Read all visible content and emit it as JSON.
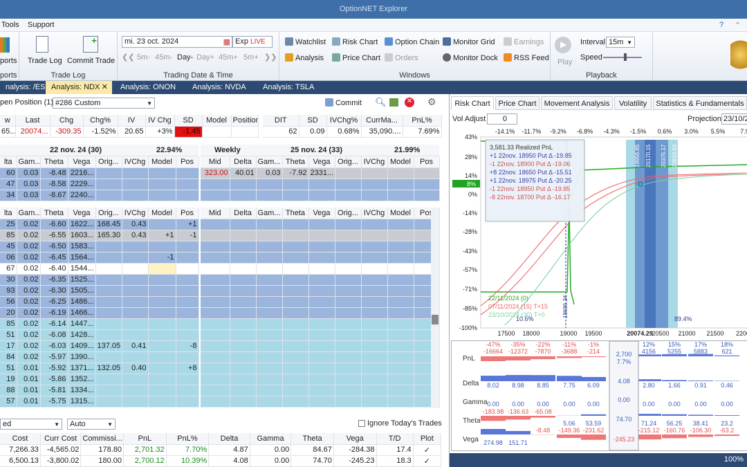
{
  "title": "OptionNET Explorer",
  "menu": [
    "Tools",
    "Support"
  ],
  "ribbon": {
    "reports": {
      "label1": "ports",
      "label2": "ports"
    },
    "tradelog": {
      "btn1": "Trade Log",
      "btn2": "Commit Trade",
      "group": "Trade Log"
    },
    "date": {
      "value": "mi. 23 oct. 2024",
      "exp": "Exp",
      "live": "LIVE",
      "steps": [
        "5m-",
        "45m-",
        "Day-",
        "Day+",
        "45m+",
        "5m+"
      ],
      "group": "Trading Date & Time"
    },
    "windows": {
      "items": [
        "Watchlist",
        "Risk Chart",
        "Option Chain",
        "Monitor Grid",
        "Earnings",
        "Analysis",
        "Price Chart",
        "Orders",
        "Monitor Dock",
        "RSS Feed"
      ],
      "group": "Windows"
    },
    "playback": {
      "play": "Play",
      "interval_label": "Interval",
      "interval": "15m",
      "speed_label": "Speed",
      "group": "Playback"
    }
  },
  "analysis_tabs": [
    "nalysis: /ES",
    "Analysis: NDX",
    "Analysis: ONON",
    "Analysis: NVDA",
    "Analysis: TSLA"
  ],
  "position": {
    "label": "pen Position (1)",
    "select": "#286 Custom",
    "commit": "Commit"
  },
  "quote": {
    "headers": [
      "w",
      "Last",
      "Chg",
      "Chg%",
      "IV",
      "IV Chg",
      "SD",
      "Model",
      "Position"
    ],
    "values": [
      "65...",
      "20074...",
      "-309.35",
      "-1.52%",
      "20.65",
      "+3%",
      "-1.45",
      "",
      ""
    ]
  },
  "stats": {
    "headers": [
      "DIT",
      "SD",
      "IVChg%",
      "CurrMa...",
      "PnL%"
    ],
    "values": [
      "62",
      "0.09",
      "0.68%",
      "35,090....",
      "7.69%"
    ]
  },
  "exp1": {
    "title": "22 nov. 24 (30)",
    "iv": "22.94%"
  },
  "exp2": {
    "title": "Weekly",
    "title2": "25 nov. 24 (33)",
    "iv": "21.99%"
  },
  "leftcols": [
    "lta",
    "Gam...",
    "Theta",
    "Vega",
    "Orig...",
    "IVChg",
    "Model",
    "Pos"
  ],
  "rightcols": [
    "Mid",
    "Delta",
    "Gam...",
    "Theta",
    "Vega",
    "Orig...",
    "IVChg",
    "Model",
    "Pos"
  ],
  "top_rows": [
    [
      "60",
      "0.03",
      "-8.48",
      "2216..."
    ],
    [
      "47",
      "0.03",
      "-8.58",
      "2229..."
    ],
    [
      "34",
      "0.03",
      "-8.67",
      "2240..."
    ]
  ],
  "weekly_row": [
    "323.00",
    "40.01",
    "0.03",
    "-7.92",
    "2331..."
  ],
  "rows": [
    [
      "25",
      "0.02",
      "-6.60",
      "1622...",
      "168.45",
      "0.43",
      "",
      "+1"
    ],
    [
      "85",
      "0.02",
      "-6.55",
      "1603...",
      "165.30",
      "0.43",
      "+1",
      "-1"
    ],
    [
      "45",
      "0.02",
      "-6.50",
      "1583...",
      "",
      "",
      "",
      ""
    ],
    [
      "06",
      "0.02",
      "-6.45",
      "1564...",
      "",
      "",
      "-1",
      ""
    ],
    [
      "67",
      "0.02",
      "-6.40",
      "1544...",
      "",
      "",
      "",
      ""
    ],
    [
      "30",
      "0.02",
      "-6.35",
      "1525...",
      "",
      "",
      "",
      ""
    ],
    [
      "93",
      "0.02",
      "-6.30",
      "1505...",
      "",
      "",
      "",
      ""
    ],
    [
      "56",
      "0.02",
      "-6.25",
      "1486...",
      "",
      "",
      "",
      ""
    ],
    [
      "20",
      "0.02",
      "-6.19",
      "1466...",
      "",
      "",
      "",
      ""
    ],
    [
      "85",
      "0.02",
      "-6.14",
      "1447...",
      "",
      "",
      "",
      ""
    ],
    [
      "51",
      "0.02",
      "-6.08",
      "1428...",
      "",
      "",
      "",
      ""
    ],
    [
      "17",
      "0.02",
      "-6.03",
      "1409...",
      "137.05",
      "0.41",
      "",
      "-8"
    ],
    [
      "84",
      "0.02",
      "-5.97",
      "1390...",
      "",
      "",
      "",
      ""
    ],
    [
      "51",
      "0.01",
      "-5.92",
      "1371...",
      "132.05",
      "0.40",
      "",
      "+8"
    ],
    [
      "19",
      "0.01",
      "-5.86",
      "1352...",
      "",
      "",
      "",
      ""
    ],
    [
      "88",
      "0.01",
      "-5.81",
      "1334...",
      "",
      "",
      "",
      ""
    ],
    [
      "57",
      "0.01",
      "-5.75",
      "1315...",
      "",
      "",
      "",
      ""
    ]
  ],
  "bottom": {
    "select1": "ed",
    "select2": "Auto",
    "ignore": "Ignore Today's Trades",
    "headers": [
      "Cost",
      "Curr Cost",
      "Commissi...",
      "PnL",
      "PnL%",
      "Delta",
      "Gamma",
      "Theta",
      "Vega",
      "T/D",
      "Plot"
    ],
    "rows": [
      [
        "7,266.33",
        "-4,565.02",
        "178.80",
        "2,701.32",
        "7.70%",
        "4.87",
        "0.00",
        "84.67",
        "-284.38",
        "17.4",
        "✓"
      ],
      [
        "6,500.13",
        "-3,800.02",
        "180.00",
        "2,700.12",
        "10.39%",
        "4.08",
        "0.00",
        "74.70",
        "-245.23",
        "18.3",
        "✓"
      ]
    ]
  },
  "right_tabs": [
    "Risk Chart",
    "Price Chart",
    "Movement Analysis",
    "Volatility",
    "Statistics & Fundamentals"
  ],
  "vol_adjust": {
    "label": "Vol Adjust",
    "value": "0",
    "projection_label": "Projection",
    "projection": "23/10/2"
  },
  "pct_axis": [
    "-14.1%",
    "-11.7%",
    "-9.2%",
    "-6.8%",
    "-4.3%",
    "-1.5%",
    "0.6%",
    "3.0%",
    "5.5%",
    "7.9"
  ],
  "y_axis": [
    "43%",
    "28%",
    "14%",
    "8%",
    "0%",
    "-14%",
    "-28%",
    "-43%",
    "-57%",
    "-71%",
    "-85%",
    "-100%"
  ],
  "x_axis": [
    "17500",
    "18000",
    "19000",
    "19500",
    "20074.29",
    "20500",
    "21000",
    "21500",
    "2200"
  ],
  "legend": {
    "title": "3,581.33 Realized PnL",
    "items": [
      "+1 22nov. 18950 Put Δ -19.85",
      "-1 22nov. 18900 Put Δ -19.06",
      "+8 22nov. 18650 Put Δ -15.51",
      "+1 22nov. 18975 Put Δ -20.25",
      "-1 22nov. 18950 Put Δ -19.85",
      "-8 22nov. 18700 Put Δ -16.17"
    ]
  },
  "lines_legend": [
    "22/11/2024 (0)",
    "07/11/2024 (15) T+15",
    "23/10/2024 (30) T+0"
  ],
  "markers": {
    "left": "10.6%",
    "right": "89.4%",
    "b1": "18686.34",
    "v1": "19956.65",
    "v2": "20170.15",
    "v3": "20375.17",
    "v4": "20810.63"
  },
  "greeks": {
    "labels": [
      "PnL",
      "Delta",
      "Gamma",
      "Theta",
      "Vega"
    ],
    "pnl_pct": [
      "-47%",
      "-35%",
      "-22%",
      "-11%",
      "-1%",
      "",
      "12%",
      "15%",
      "17%",
      "18%"
    ],
    "pnl_val": [
      "-16664",
      "-12372",
      "-7870",
      "-3688",
      "-214",
      "",
      "4156",
      "5255",
      "5883",
      "621"
    ],
    "delta": [
      "8.02",
      "8.98",
      "8.85",
      "7.75",
      "6.09",
      "",
      "2.80",
      "1.66",
      "0.91",
      "0.46"
    ],
    "gamma": [
      "0.00",
      "0.00",
      "0.00",
      "0.00",
      "0.00",
      "",
      "0.00",
      "0.00",
      "0.00",
      "0.00"
    ],
    "theta": [
      "-183.98",
      "-136.63",
      "-65.08",
      "5.06",
      "53.59",
      "",
      "71.24",
      "56.25",
      "38.41",
      "23.2"
    ],
    "vega": [
      "274.98",
      "151.71",
      "-8.48",
      "-149.36",
      "-231.62",
      "",
      "-215.12",
      "-160.76",
      "-106.30",
      "-63.2"
    ],
    "center": {
      "pnl": "2,700",
      "pnl_pct": "7.7%",
      "delta": "4.08",
      "gamma": "0.00",
      "theta": "74.70",
      "vega": "-245.23"
    }
  },
  "zoom": "100%"
}
